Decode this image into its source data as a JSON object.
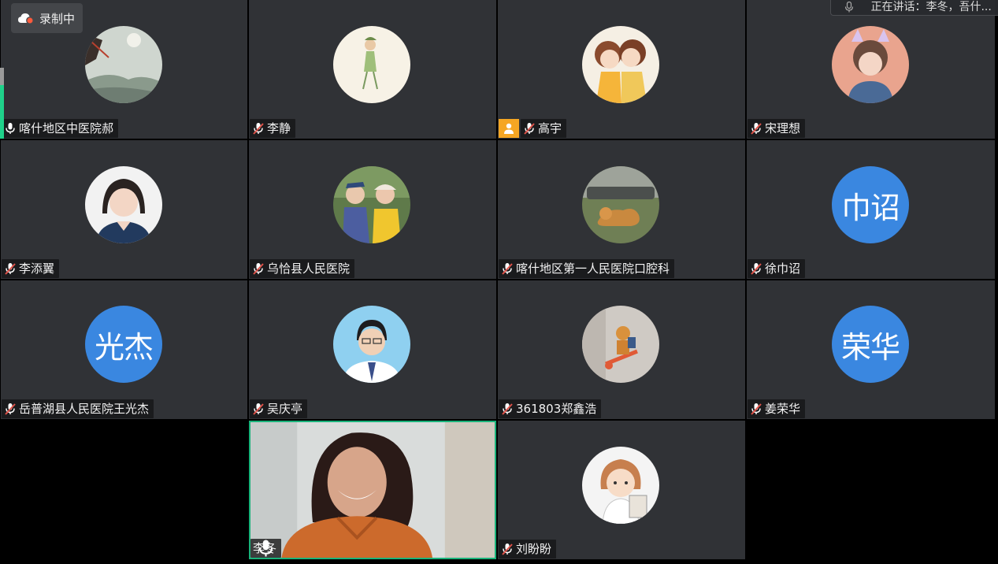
{
  "recording": {
    "label": "录制中"
  },
  "speaking": {
    "text": "正在讲话：李冬，吾什..."
  },
  "participants": [
    {
      "name": "喀什地区中医院郝",
      "mic": "on"
    },
    {
      "name": "李静",
      "mic": "muted"
    },
    {
      "name": "高宇",
      "mic": "muted",
      "host": true
    },
    {
      "name": "宋理想",
      "mic": "muted"
    },
    {
      "name": "李添翼",
      "mic": "muted"
    },
    {
      "name": "乌恰县人民医院",
      "mic": "muted"
    },
    {
      "name": "喀什地区第一人民医院口腔科",
      "mic": "muted"
    },
    {
      "name": "徐巾诏",
      "mic": "muted",
      "avatar_text": "巾诏"
    },
    {
      "name": "岳普湖县人民医院王光杰",
      "mic": "muted",
      "avatar_text": "光杰"
    },
    {
      "name": "吴庆亭",
      "mic": "muted"
    },
    {
      "name": "361803郑鑫浩",
      "mic": "muted"
    },
    {
      "name": "姜荣华",
      "mic": "muted",
      "avatar_text": "荣华"
    },
    {
      "name": "李冬",
      "mic": "on",
      "video": true
    },
    {
      "name": "刘盼盼",
      "mic": "muted"
    }
  ],
  "colors": {
    "tile_bg": "#303236",
    "grid_bg": "#000000",
    "text_avatar_bg": "#3a87e0",
    "active_speaker_border": "#19b37a",
    "host_badge": "#f5a623",
    "muted_mic": "#e0534a"
  }
}
